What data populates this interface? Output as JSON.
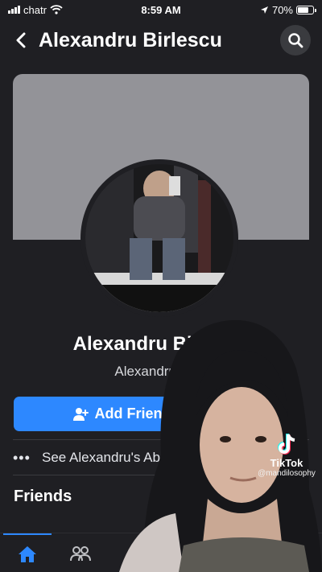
{
  "status_bar": {
    "carrier": "chatr",
    "time": "8:59 AM",
    "battery": "70%",
    "battery_level": 0.7
  },
  "header": {
    "title": "Alexandru Birlescu"
  },
  "profile": {
    "name": "Alexandru Birlescu",
    "subtitle": "Alexandru Birle"
  },
  "actions": {
    "add_friend_label": "Add Friend"
  },
  "about": {
    "label": "See Alexandru's Ab"
  },
  "sections": {
    "friends": "Friends"
  },
  "watermark": {
    "brand": "TikTok",
    "handle": "@mandilosophy"
  },
  "icons": {
    "back": "chevron-left-icon",
    "search": "search-icon",
    "add_friend": "add-person-icon",
    "more": "more-dots-icon",
    "home": "home-icon",
    "friends_tab": "friends-icon",
    "tiktok": "tiktok-logo"
  },
  "colors": {
    "accent": "#2d88ff",
    "background": "#1f1f23",
    "cover": "#939398"
  }
}
